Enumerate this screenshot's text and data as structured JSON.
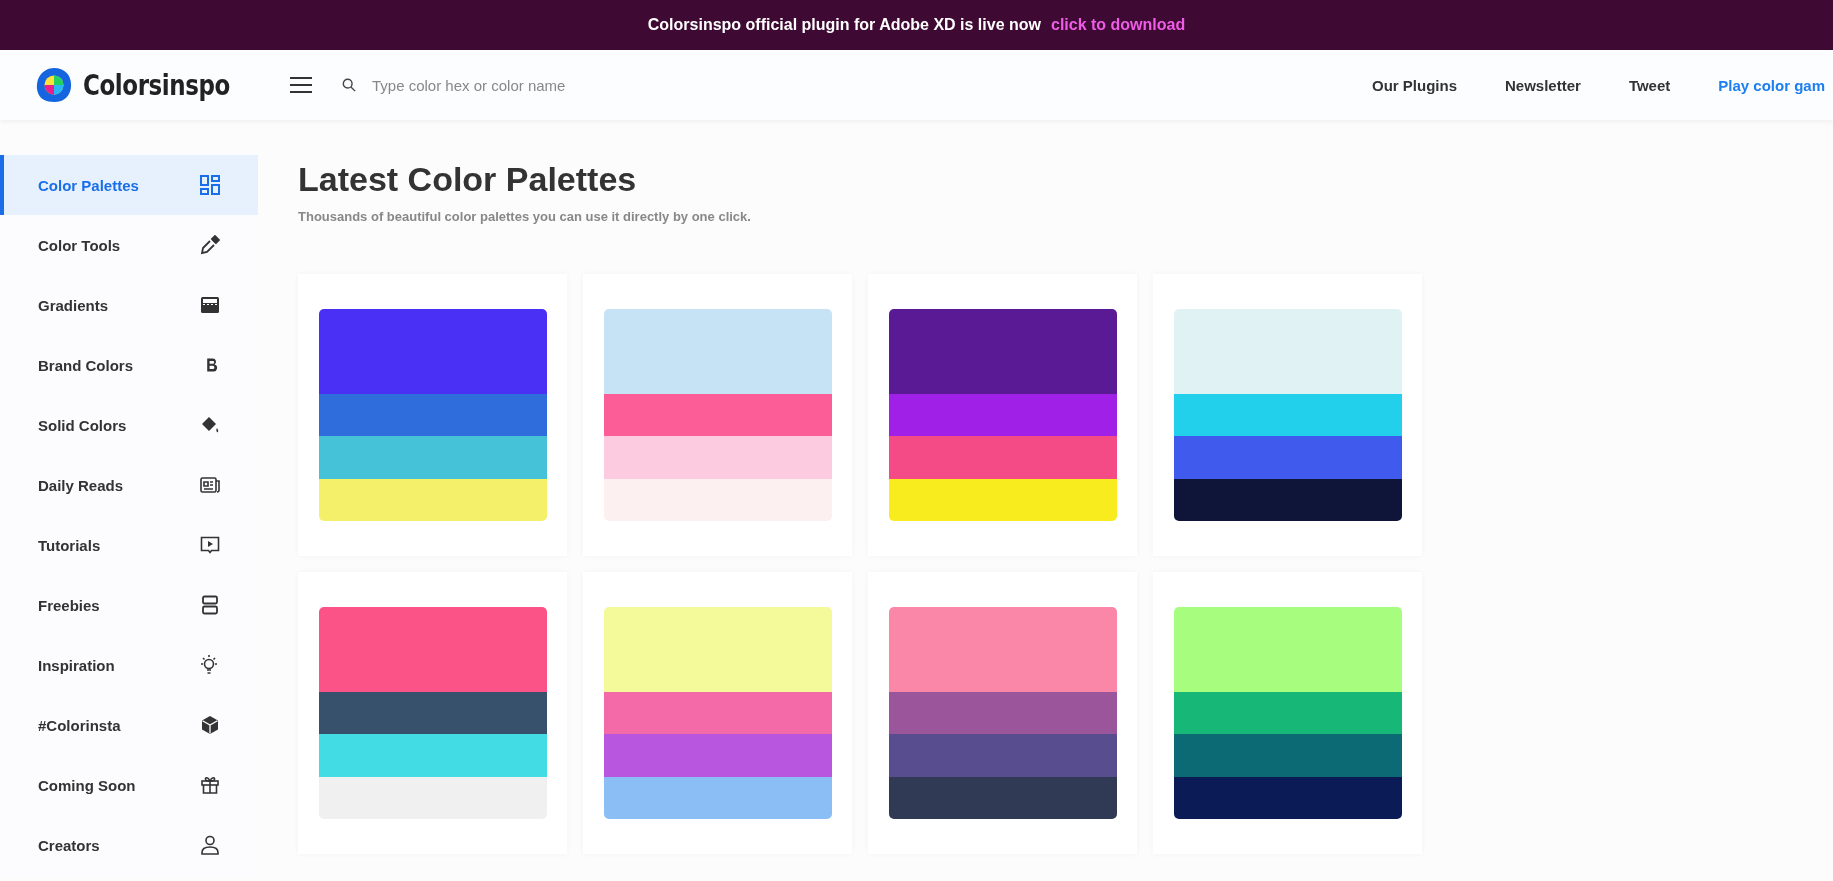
{
  "banner": {
    "text": "Colorsinspo official plugin for Adobe XD is live now",
    "link": "click to download"
  },
  "header": {
    "logo": "Colorsinspo",
    "search": {
      "placeholder": "Type color hex or color name"
    },
    "nav": [
      {
        "label": "Our Plugins",
        "kind": "plain"
      },
      {
        "label": "Newsletter",
        "kind": "plain"
      },
      {
        "label": "Tweet",
        "kind": "plain"
      },
      {
        "label": "Play color gam",
        "kind": "accent"
      }
    ]
  },
  "sidebar": {
    "items": [
      {
        "label": "Color Palettes",
        "selected": true
      },
      {
        "label": "Color Tools",
        "selected": false
      },
      {
        "label": "Gradients",
        "selected": false
      },
      {
        "label": "Brand Colors",
        "selected": false
      },
      {
        "label": "Solid Colors",
        "selected": false
      },
      {
        "label": "Daily Reads",
        "selected": false
      },
      {
        "label": "Tutorials",
        "selected": false
      },
      {
        "label": "Freebies",
        "selected": false
      },
      {
        "label": "Inspiration",
        "selected": false
      },
      {
        "label": "#Colorinsta",
        "selected": false
      },
      {
        "label": "Coming Soon",
        "selected": false
      },
      {
        "label": "Creators",
        "selected": false
      }
    ]
  },
  "main": {
    "title": "Latest Color Palettes",
    "subtitle": "Thousands of beautiful color palettes you can use it directly by one click.",
    "palettes": [
      {
        "colors": [
          {
            "color": "#4a2ff5"
          },
          {
            "color": "#2f6ddd"
          },
          {
            "color": "#45c1d8"
          },
          {
            "color": "#f4f06a"
          }
        ]
      },
      {
        "colors": [
          {
            "color": "#c5e3f5"
          },
          {
            "color": "#fd5d97"
          },
          {
            "color": "#fdcbe0"
          },
          {
            "color": "#fdf0f0"
          }
        ]
      },
      {
        "colors": [
          {
            "color": "#5a1a96"
          },
          {
            "color": "#a020e8"
          },
          {
            "color": "#f44a86"
          },
          {
            "color": "#f9ec1e"
          }
        ]
      },
      {
        "colors": [
          {
            "color": "#e0f2f3"
          },
          {
            "color": "#22d0ec"
          },
          {
            "color": "#3f5aed"
          },
          {
            "color": "#0e1538"
          }
        ]
      },
      {
        "colors": [
          {
            "color": "#fb5387"
          },
          {
            "color": "#37506b"
          },
          {
            "color": "#42dce4"
          },
          {
            "color": "#f0f0f0"
          }
        ]
      },
      {
        "colors": [
          {
            "color": "#f4f999"
          },
          {
            "color": "#f46aa9"
          },
          {
            "color": "#b856e0"
          },
          {
            "color": "#8bbef5"
          }
        ]
      },
      {
        "colors": [
          {
            "color": "#fb87a8"
          },
          {
            "color": "#9b569b"
          },
          {
            "color": "#584d8f"
          },
          {
            "color": "#313a55"
          }
        ]
      },
      {
        "colors": [
          {
            "color": "#a6fd7e"
          },
          {
            "color": "#17b877"
          },
          {
            "color": "#0b6a73"
          },
          {
            "color": "#0b1b56"
          }
        ]
      }
    ]
  }
}
